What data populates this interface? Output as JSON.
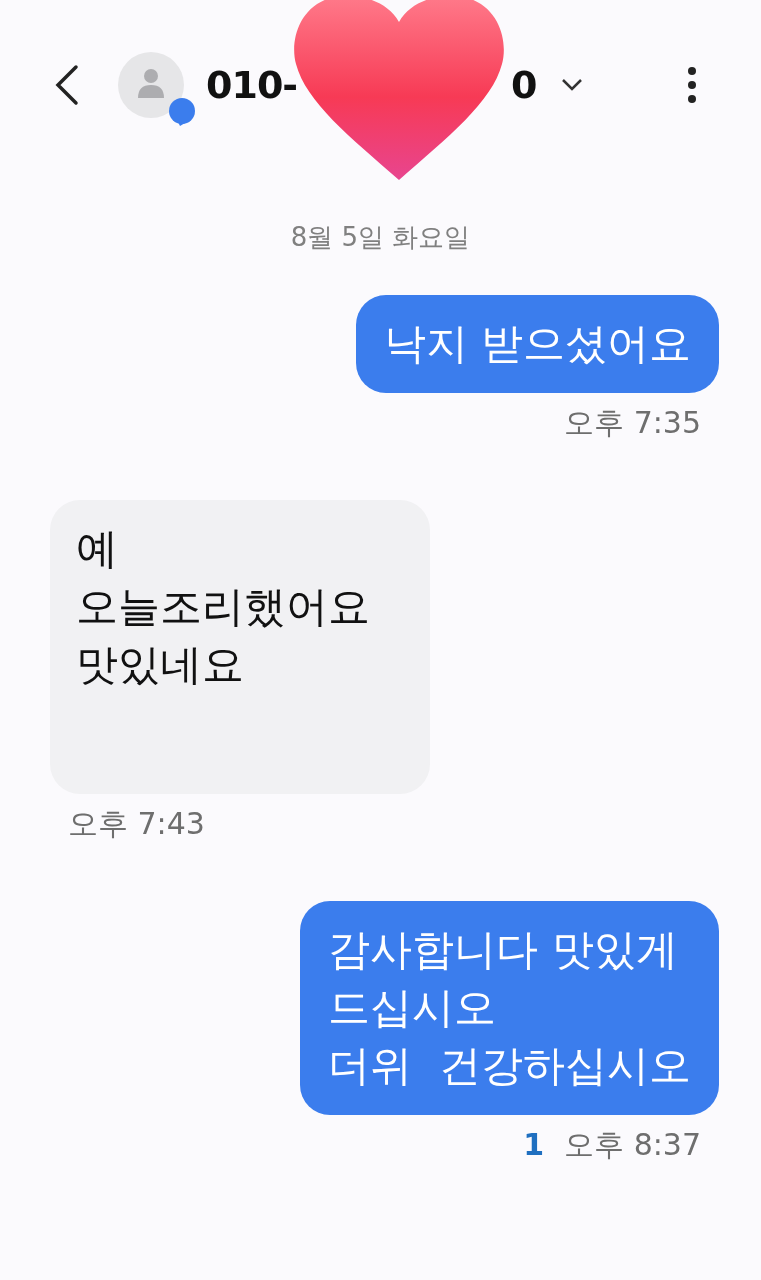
{
  "header": {
    "title_parts": [
      "010-",
      "0"
    ]
  },
  "date_divider": "8월 5일 화요일",
  "messages": [
    {
      "kind": "sent",
      "text": "낙지 받으셨어요",
      "time": "오후 7:35"
    },
    {
      "kind": "received",
      "text": "예\n오늘조리했어요\n맛있네요",
      "time": "오후 7:43"
    },
    {
      "kind": "sent",
      "text": "감사합니다 맛있게\n드십시오\n더위  건강하십시오",
      "time": "오후 8:37",
      "unread": "1"
    }
  ]
}
